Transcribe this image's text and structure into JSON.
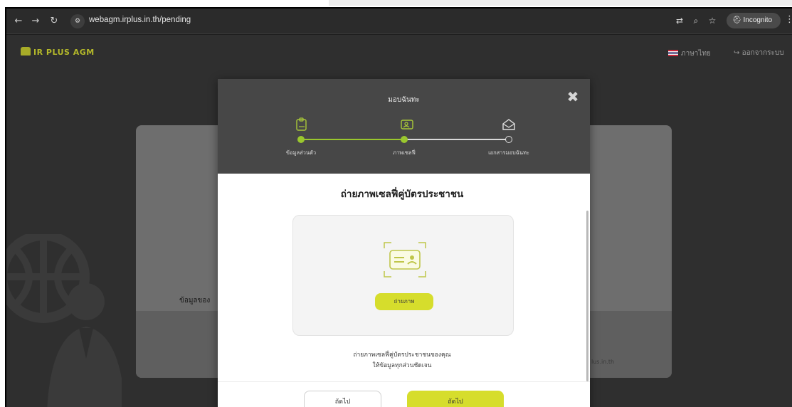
{
  "browser": {
    "url": "webagm.irplus.in.th/pending",
    "incognito_label": "Incognito",
    "icons": [
      "back-icon",
      "forward-icon",
      "reload-icon",
      "site-settings-icon",
      "translate-icon",
      "zoom-icon",
      "star-icon",
      "incognito-icon",
      "menu-icon"
    ]
  },
  "header": {
    "logo": "IR PLUS AGM",
    "language": "ภาษาไทย",
    "logout": "ออกจากระบบ"
  },
  "background": {
    "section_label": "ข้อมูลของ",
    "footer_text": "lus.in.th"
  },
  "modal": {
    "title": "มอบฉันทะ",
    "steps": [
      {
        "label": "ข้อมูลส่วนตัว",
        "state": "done"
      },
      {
        "label": "ภาพเซลฟี่",
        "state": "active"
      },
      {
        "label": "เอกสารมอบฉันทะ",
        "state": "pending"
      }
    ],
    "body_title": "ถ่ายภาพเซลฟี่คู่บัตรประชาชน",
    "capture_button": "ถ่ายภาพ",
    "hint_line1": "ถ่ายภาพเซลฟี่คู่บัตรประชาชนของคุณ",
    "hint_line2": "ให้ข้อมูลทุกส่วนชัดเจน",
    "back_button": "ถัดไป",
    "next_button": "ถัดไป"
  },
  "colors": {
    "accent": "#d6dd2c",
    "modal_header": "#474747",
    "backdrop": "#2f2f2f"
  }
}
